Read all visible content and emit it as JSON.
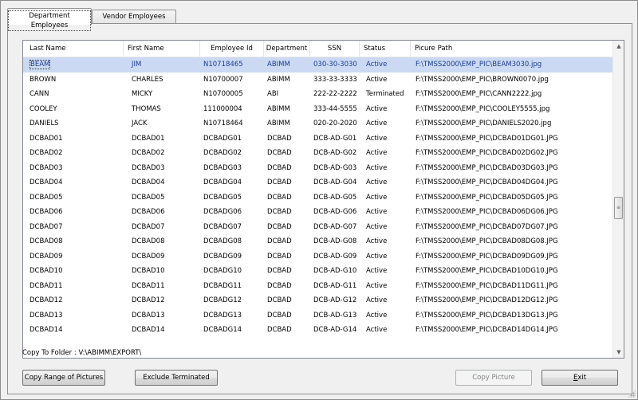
{
  "tabs": [
    {
      "label": "Department Employees",
      "active": true
    },
    {
      "label": "Vendor Employees",
      "active": false
    }
  ],
  "grid": {
    "columns": [
      "Last Name",
      "First Name",
      "Employee Id",
      "Department",
      "SSN",
      "Status",
      "Picure Path"
    ],
    "selected_row": 0,
    "rows": [
      [
        "BEAM",
        "JIM",
        "N10718465",
        "ABIMM",
        "030-30-3030",
        "Active",
        "F:\\TMSS2000\\EMP_PIC\\BEAM3030.jpg"
      ],
      [
        "BROWN",
        "CHARLES",
        "N10700007",
        "ABIMM",
        "333-33-3333",
        "Active",
        "F:\\TMSS2000\\EMP_PIC\\BROWN0070.jpg"
      ],
      [
        "CANN",
        "MICKY",
        "N10700005",
        "ABI",
        "222-22-2222",
        "Terminated",
        "F:\\TMSS2000\\EMP_PIC\\CANN2222.jpg"
      ],
      [
        "COOLEY",
        "THOMAS",
        "111000004",
        "ABIMM",
        "333-44-5555",
        "Active",
        "F:\\TMSS2000\\EMP_PIC\\COOLEY5555.jpg"
      ],
      [
        "DANIELS",
        "JACK",
        "N10718464",
        "ABIMM",
        "020-20-2020",
        "Active",
        "F:\\TMSS2000\\EMP_PIC\\DANIELS2020.jpg"
      ],
      [
        "DCBAD01",
        "DCBAD01",
        "DCBADG01",
        "DCBAD",
        "DCB-AD-G01",
        "Active",
        "F:\\TMSS2000\\EMP_PIC\\DCBAD01DG01.JPG"
      ],
      [
        "DCBAD02",
        "DCBAD02",
        "DCBADG02",
        "DCBAD",
        "DCB-AD-G02",
        "Active",
        "F:\\TMSS2000\\EMP_PIC\\DCBAD02DG02.JPG"
      ],
      [
        "DCBAD03",
        "DCBAD03",
        "DCBADG03",
        "DCBAD",
        "DCB-AD-G03",
        "Active",
        "F:\\TMSS2000\\EMP_PIC\\DCBAD03DG03.JPG"
      ],
      [
        "DCBAD04",
        "DCBAD04",
        "DCBADG04",
        "DCBAD",
        "DCB-AD-G04",
        "Active",
        "F:\\TMSS2000\\EMP_PIC\\DCBAD04DG04.JPG"
      ],
      [
        "DCBAD05",
        "DCBAD05",
        "DCBADG05",
        "DCBAD",
        "DCB-AD-G05",
        "Active",
        "F:\\TMSS2000\\EMP_PIC\\DCBAD05DG05.JPG"
      ],
      [
        "DCBAD06",
        "DCBAD06",
        "DCBADG06",
        "DCBAD",
        "DCB-AD-G06",
        "Active",
        "F:\\TMSS2000\\EMP_PIC\\DCBAD06DG06.JPG"
      ],
      [
        "DCBAD07",
        "DCBAD07",
        "DCBADG07",
        "DCBAD",
        "DCB-AD-G07",
        "Active",
        "F:\\TMSS2000\\EMP_PIC\\DCBAD07DG07.JPG"
      ],
      [
        "DCBAD08",
        "DCBAD08",
        "DCBADG08",
        "DCBAD",
        "DCB-AD-G08",
        "Active",
        "F:\\TMSS2000\\EMP_PIC\\DCBAD08DG08.JPG"
      ],
      [
        "DCBAD09",
        "DCBAD09",
        "DCBADG09",
        "DCBAD",
        "DCB-AD-G09",
        "Active",
        "F:\\TMSS2000\\EMP_PIC\\DCBAD09DG09.JPG"
      ],
      [
        "DCBAD10",
        "DCBAD10",
        "DCBADG10",
        "DCBAD",
        "DCB-AD-G10",
        "Active",
        "F:\\TMSS2000\\EMP_PIC\\DCBAD10DG10.JPG"
      ],
      [
        "DCBAD11",
        "DCBAD11",
        "DCBADG11",
        "DCBAD",
        "DCB-AD-G11",
        "Active",
        "F:\\TMSS2000\\EMP_PIC\\DCBAD11DG11.JPG"
      ],
      [
        "DCBAD12",
        "DCBAD12",
        "DCBADG12",
        "DCBAD",
        "DCB-AD-G12",
        "Active",
        "F:\\TMSS2000\\EMP_PIC\\DCBAD12DG12.JPG"
      ],
      [
        "DCBAD13",
        "DCBAD13",
        "DCBADG13",
        "DCBAD",
        "DCB-AD-G13",
        "Active",
        "F:\\TMSS2000\\EMP_PIC\\DCBAD13DG13.JPG"
      ],
      [
        "DCBAD14",
        "DCBAD14",
        "DCBADG14",
        "DCBAD",
        "DCB-AD-G14",
        "Active",
        "F:\\TMSS2000\\EMP_PIC\\DCBAD14DG14.JPG"
      ]
    ]
  },
  "icons": {
    "scroll_up": "scroll-up-arrow-icon",
    "scroll_down": "scroll-down-arrow-icon",
    "scroll_thumb": "scroll-thumb-grip-icon",
    "resize_grip": "resize-grip-icon"
  },
  "folder": {
    "label": "Copy To Folder :",
    "path": "V:\\ABIMM\\EXPORT\\"
  },
  "buttons": {
    "copy_range": "Copy Range of Pictures",
    "exclude_terminated": "Exclude Terminated",
    "copy_picture": "Copy Picture",
    "exit_mnemonic": "E",
    "exit_rest": "xit"
  },
  "colors": {
    "selected_row_bg": "#cbdaf2",
    "selected_row_text": "#1c3a93",
    "window_bg": "#f0f0f0"
  }
}
